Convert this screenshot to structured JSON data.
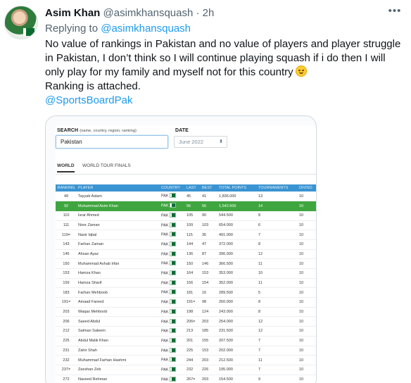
{
  "tweet": {
    "author_name": "Asim Khan",
    "handle": "@asimkhansquash",
    "separator": "·",
    "time": "2h",
    "replying_prefix": "Replying to",
    "replying_to": "@asimkhansquash",
    "text_lines": [
      "No value of rankings in Pakistan and no value of players and player struggle",
      "in Pakistan, I don’t think so I will continue playing squash if i do then I will",
      "only play for my family and myself not for this country",
      "Ranking is attached."
    ],
    "emoji": "smiling-face",
    "mention": "@SportsBoardPak",
    "more_icon": "more-horizontal-icon"
  },
  "ranking_image": {
    "search_label": "SEARCH",
    "search_hint": "(name, country, region, ranking)",
    "search_value": "Pakistan",
    "date_label": "DATE",
    "date_value": "June 2022",
    "tabs": [
      "WORLD",
      "WORLD TOUR FINALS"
    ],
    "columns": [
      "RANKING",
      "PLAYER",
      "COUNTRY",
      "LAST",
      "BEST",
      "TOTAL POINTS",
      "TOURNAMENTS",
      "DIVISO"
    ],
    "highlight_color": "#3fa63f",
    "header_color": "#3a94d2",
    "rows": [
      [
        "49",
        "Tayyab Aslam",
        "PAK",
        "45",
        "41",
        "1,836.000",
        "13",
        "10"
      ],
      [
        "92",
        "Muhammad Asim Khan",
        "PAK",
        "56",
        "56",
        "1,542.500",
        "14",
        "10"
      ],
      [
        "110",
        "Israr Ahmed",
        "PAK",
        "105",
        "90",
        "544.500",
        "8",
        "10"
      ],
      [
        "111",
        "Noor Zaman",
        "PAK",
        "109",
        "103",
        "654.000",
        "6",
        "10"
      ],
      [
        "119=",
        "Nasir Iqbal",
        "PAK",
        "115",
        "35",
        "491.000",
        "7",
        "10"
      ],
      [
        "143",
        "Farhan Zaman",
        "PAK",
        "144",
        "47",
        "372.000",
        "8",
        "10"
      ],
      [
        "145",
        "Ahsan Ayaz",
        "PAK",
        "136",
        "87",
        "396.000",
        "12",
        "10"
      ],
      [
        "150",
        "Muhammad Ashab Irfan",
        "PAK",
        "150",
        "146",
        "366.500",
        "11",
        "10"
      ],
      [
        "153",
        "Hamza Khan",
        "PAK",
        "164",
        "153",
        "353.000",
        "10",
        "10"
      ],
      [
        "159",
        "Hamza Sharif",
        "PAK",
        "156",
        "154",
        "352.000",
        "11",
        "10"
      ],
      [
        "183",
        "Farhan Mehboob",
        "PAK",
        "181",
        "16",
        "289.500",
        "5",
        "10"
      ],
      [
        "191=",
        "Amaad Fareed",
        "PAK",
        "191=",
        "98",
        "260.000",
        "8",
        "10"
      ],
      [
        "203",
        "Waqas Mehboob",
        "PAK",
        "198",
        "124",
        "243.000",
        "8",
        "10"
      ],
      [
        "206",
        "Saeed Abdul",
        "PAK",
        "206=",
        "203",
        "254.000",
        "12",
        "10"
      ],
      [
        "212",
        "Salman Saleem",
        "PAK",
        "213",
        "185",
        "231.500",
        "12",
        "10"
      ],
      [
        "225",
        "Abdul Malik Khan",
        "PAK",
        "201",
        "155",
        "207.500",
        "7",
        "10"
      ],
      [
        "231",
        "Zahir Shah",
        "PAK",
        "225",
        "153",
        "202.000",
        "7",
        "10"
      ],
      [
        "232",
        "Muhammad Farhan Hashmi",
        "PAK",
        "244",
        "203",
        "212.500",
        "11",
        "10"
      ],
      [
        "237=",
        "Zeeshan Zeb",
        "PAK",
        "232",
        "226",
        "195.000",
        "7",
        "10"
      ],
      [
        "272",
        "Naveed Rehman",
        "PAK",
        "267=",
        "203",
        "154.500",
        "9",
        "10"
      ]
    ],
    "highlighted_row": 1
  }
}
